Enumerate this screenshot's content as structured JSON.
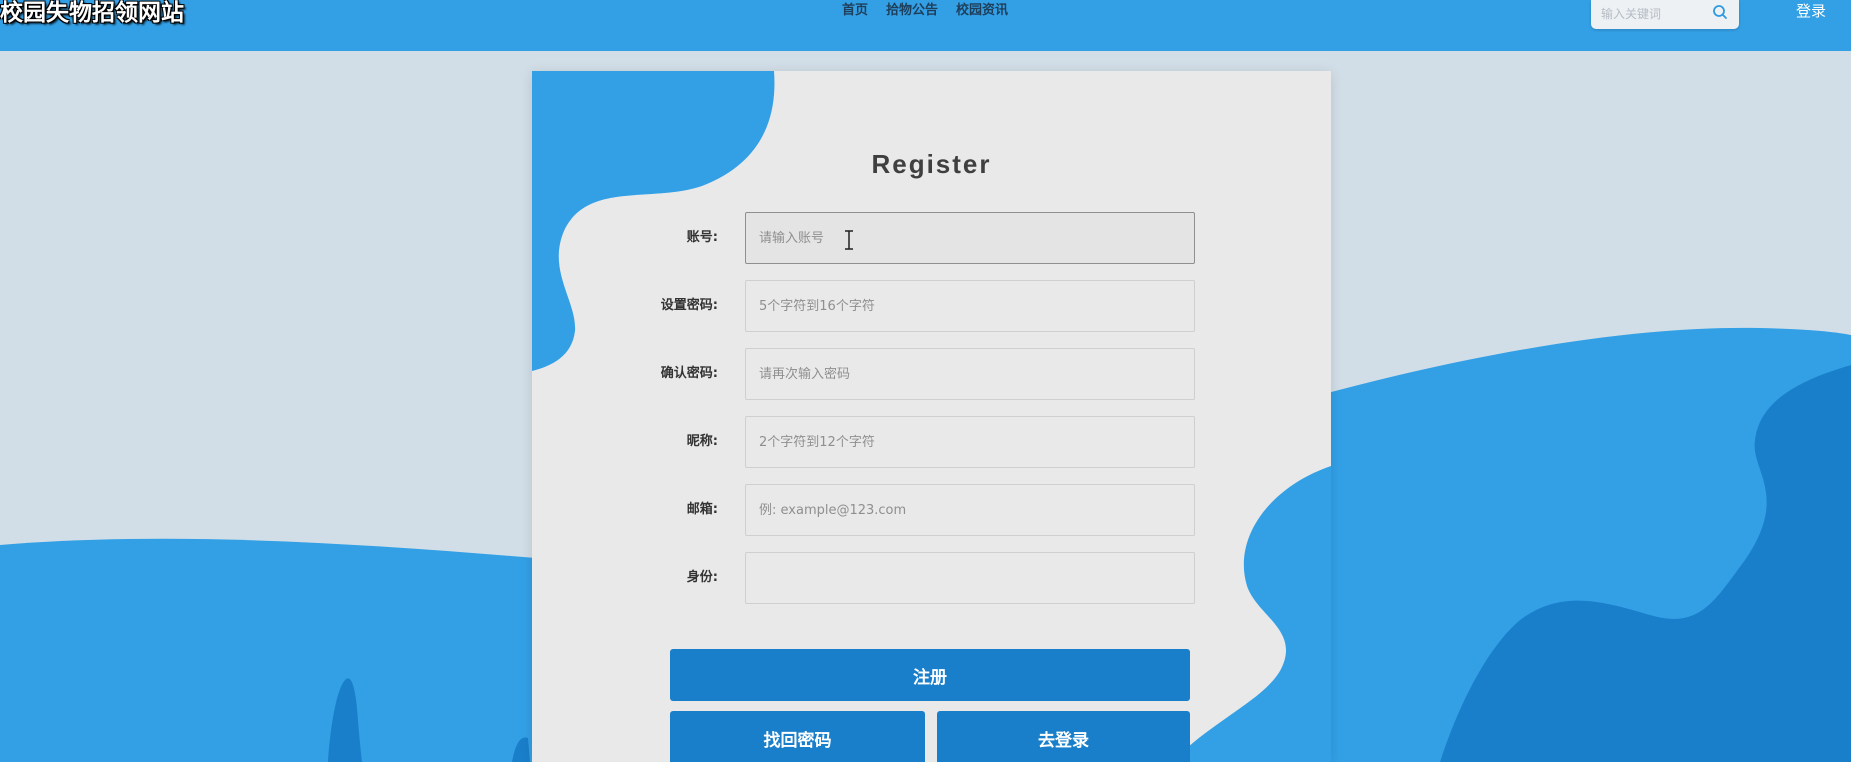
{
  "header": {
    "site_title": "校园失物招领网站",
    "nav": [
      {
        "label": "首页"
      },
      {
        "label": "拾物公告"
      },
      {
        "label": "校园资讯"
      }
    ],
    "search": {
      "placeholder": "输入关键词",
      "icon": "search-icon"
    },
    "login_label": "登录"
  },
  "register_form": {
    "title": "Register",
    "fields": [
      {
        "label": "账号:",
        "placeholder": "请输入账号",
        "value": ""
      },
      {
        "label": "设置密码:",
        "placeholder": "5个字符到16个字符",
        "value": ""
      },
      {
        "label": "确认密码:",
        "placeholder": "请再次输入密码",
        "value": ""
      },
      {
        "label": "昵称:",
        "placeholder": "2个字符到12个字符",
        "value": ""
      },
      {
        "label": "邮箱:",
        "placeholder": "例: example@123.com",
        "value": ""
      },
      {
        "label": "身份:",
        "selected": ""
      }
    ],
    "buttons": {
      "register": "注册",
      "recover_password": "找回密码",
      "go_login": "去登录"
    }
  },
  "colors": {
    "primary": "#33a0e6",
    "button": "#1a7fca",
    "page_background": "#d2dee7",
    "card_background": "#e9e9e9",
    "dark_shape": "#1a7fca"
  }
}
